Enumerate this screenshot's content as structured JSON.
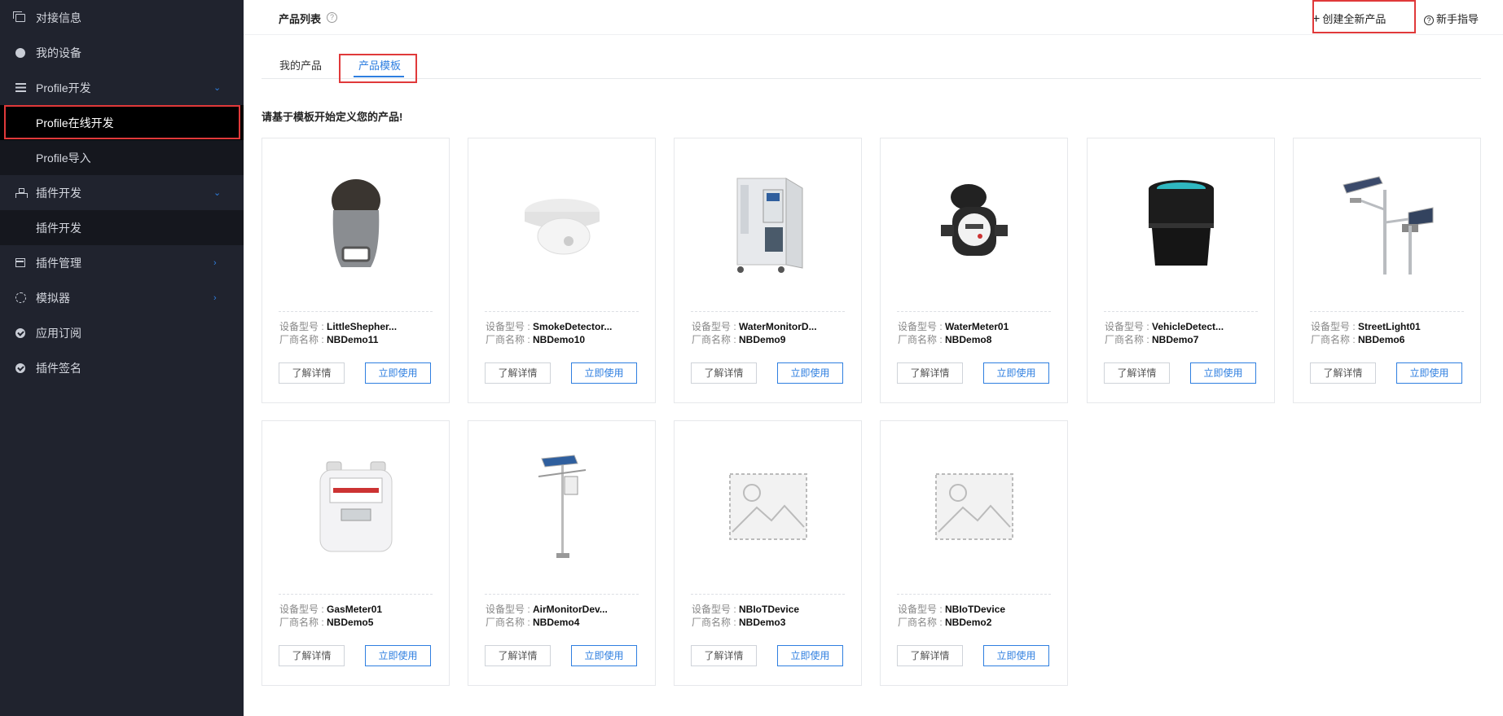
{
  "sidebar": {
    "items": [
      {
        "label": "对接信息",
        "icon": "window-icon"
      },
      {
        "label": "我的设备",
        "icon": "device-icon"
      },
      {
        "label": "Profile开发",
        "icon": "list-icon"
      },
      {
        "label": "Profile在线开发"
      },
      {
        "label": "Profile导入"
      },
      {
        "label": "插件开发",
        "icon": "tree-icon"
      },
      {
        "label": "插件开发"
      },
      {
        "label": "插件管理",
        "icon": "panel-icon"
      },
      {
        "label": "模拟器",
        "icon": "simulator-icon"
      },
      {
        "label": "应用订阅",
        "icon": "subscribe-icon"
      },
      {
        "label": "插件签名",
        "icon": "sign-icon"
      }
    ]
  },
  "header": {
    "title": "产品列表",
    "create_label": "创建全新产品",
    "guide_label": "新手指导"
  },
  "tabs": {
    "mine": "我的产品",
    "template": "产品模板"
  },
  "hint": "请基于模板开始定义您的产品!",
  "labels": {
    "model": "设备型号 : ",
    "vendor": "厂商名称 : ",
    "detail": "了解详情",
    "use": "立即使用"
  },
  "products": [
    {
      "model": "LittleShepher...",
      "vendor": "NBDemo11",
      "icon": "locator-device-icon"
    },
    {
      "model": "SmokeDetector...",
      "vendor": "NBDemo10",
      "icon": "smoke-detector-icon"
    },
    {
      "model": "WaterMonitorD...",
      "vendor": "NBDemo9",
      "icon": "water-monitor-cabinet-icon"
    },
    {
      "model": "WaterMeter01",
      "vendor": "NBDemo8",
      "icon": "water-meter-icon"
    },
    {
      "model": "VehicleDetect...",
      "vendor": "NBDemo7",
      "icon": "vehicle-detector-icon"
    },
    {
      "model": "StreetLight01",
      "vendor": "NBDemo6",
      "icon": "street-light-icon"
    },
    {
      "model": "GasMeter01",
      "vendor": "NBDemo5",
      "icon": "gas-meter-icon"
    },
    {
      "model": "AirMonitorDev...",
      "vendor": "NBDemo4",
      "icon": "air-monitor-icon"
    },
    {
      "model": "NBIoTDevice",
      "vendor": "NBDemo3",
      "icon": "image-placeholder-icon"
    },
    {
      "model": "NBIoTDevice",
      "vendor": "NBDemo2",
      "icon": "image-placeholder-icon"
    }
  ]
}
